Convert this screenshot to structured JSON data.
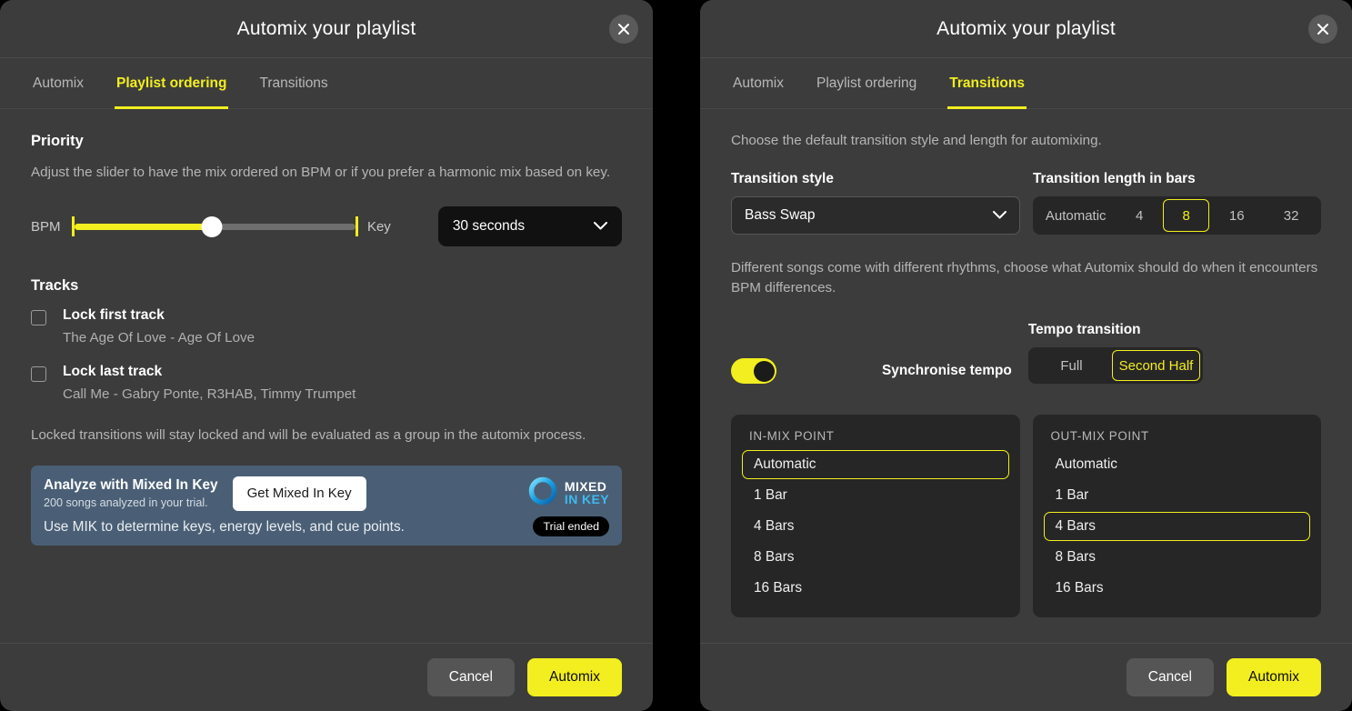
{
  "colors": {
    "accent": "#f2ee1f",
    "panel": "#3c3c3c",
    "card": "#262626",
    "banner": "#4a5f75",
    "mik_blue": "#3fb9f0"
  },
  "left_dialog": {
    "title": "Automix your playlist",
    "close_icon": "close-icon",
    "tabs": [
      {
        "label": "Automix",
        "active": false
      },
      {
        "label": "Playlist ordering",
        "active": true
      },
      {
        "label": "Transitions",
        "active": false
      }
    ],
    "priority": {
      "heading": "Priority",
      "description": "Adjust the slider to have the mix ordered on BPM or if you prefer a harmonic mix based on key.",
      "slider": {
        "left_label": "BPM",
        "right_label": "Key",
        "value_percent": 49
      },
      "duration_select": {
        "value": "30 seconds",
        "chevron_icon": "chevron-down-icon"
      }
    },
    "tracks": {
      "heading": "Tracks",
      "items": [
        {
          "label": "Lock first track",
          "subtitle": "The Age Of Love - Age Of Love",
          "checked": false
        },
        {
          "label": "Lock last track",
          "subtitle": "Call Me - Gabry Ponte, R3HAB, Timmy Trumpet",
          "checked": false
        }
      ],
      "note": "Locked transitions will stay locked and will be evaluated as a group in the automix process."
    },
    "mik_banner": {
      "headline": "Analyze with Mixed In Key",
      "subline": "200 songs analyzed in your trial.",
      "button": "Get Mixed In Key",
      "bottom_text": "Use MIK to determine keys, energy levels, and cue points.",
      "logo_word1": "MIXED",
      "logo_word2": "IN KEY",
      "badge": "Trial ended"
    },
    "footer": {
      "cancel": "Cancel",
      "primary": "Automix"
    }
  },
  "right_dialog": {
    "title": "Automix your playlist",
    "close_icon": "close-icon",
    "tabs": [
      {
        "label": "Automix",
        "active": false
      },
      {
        "label": "Playlist ordering",
        "active": false
      },
      {
        "label": "Transitions",
        "active": true
      }
    ],
    "intro": "Choose the default transition style and length for automixing.",
    "transition_style": {
      "label": "Transition style",
      "value": "Bass Swap",
      "chevron_icon": "chevron-down-icon"
    },
    "transition_length": {
      "label": "Transition length in bars",
      "options": [
        "Automatic",
        "4",
        "8",
        "16",
        "32"
      ],
      "selected": "8"
    },
    "bpm_note": "Different songs come with different rhythms, choose what Automix should do when it encounters BPM differences.",
    "sync": {
      "toggle_on": true,
      "label": "Synchronise tempo"
    },
    "tempo_transition": {
      "label": "Tempo transition",
      "options": [
        "Full",
        "Second Half"
      ],
      "selected": "Second Half"
    },
    "in_mix": {
      "title": "IN-MIX POINT",
      "options": [
        "Automatic",
        "1 Bar",
        "4 Bars",
        "8 Bars",
        "16 Bars"
      ],
      "selected": "Automatic"
    },
    "out_mix": {
      "title": "OUT-MIX POINT",
      "options": [
        "Automatic",
        "1 Bar",
        "4 Bars",
        "8 Bars",
        "16 Bars"
      ],
      "selected": "4 Bars"
    },
    "footer": {
      "cancel": "Cancel",
      "primary": "Automix"
    }
  }
}
